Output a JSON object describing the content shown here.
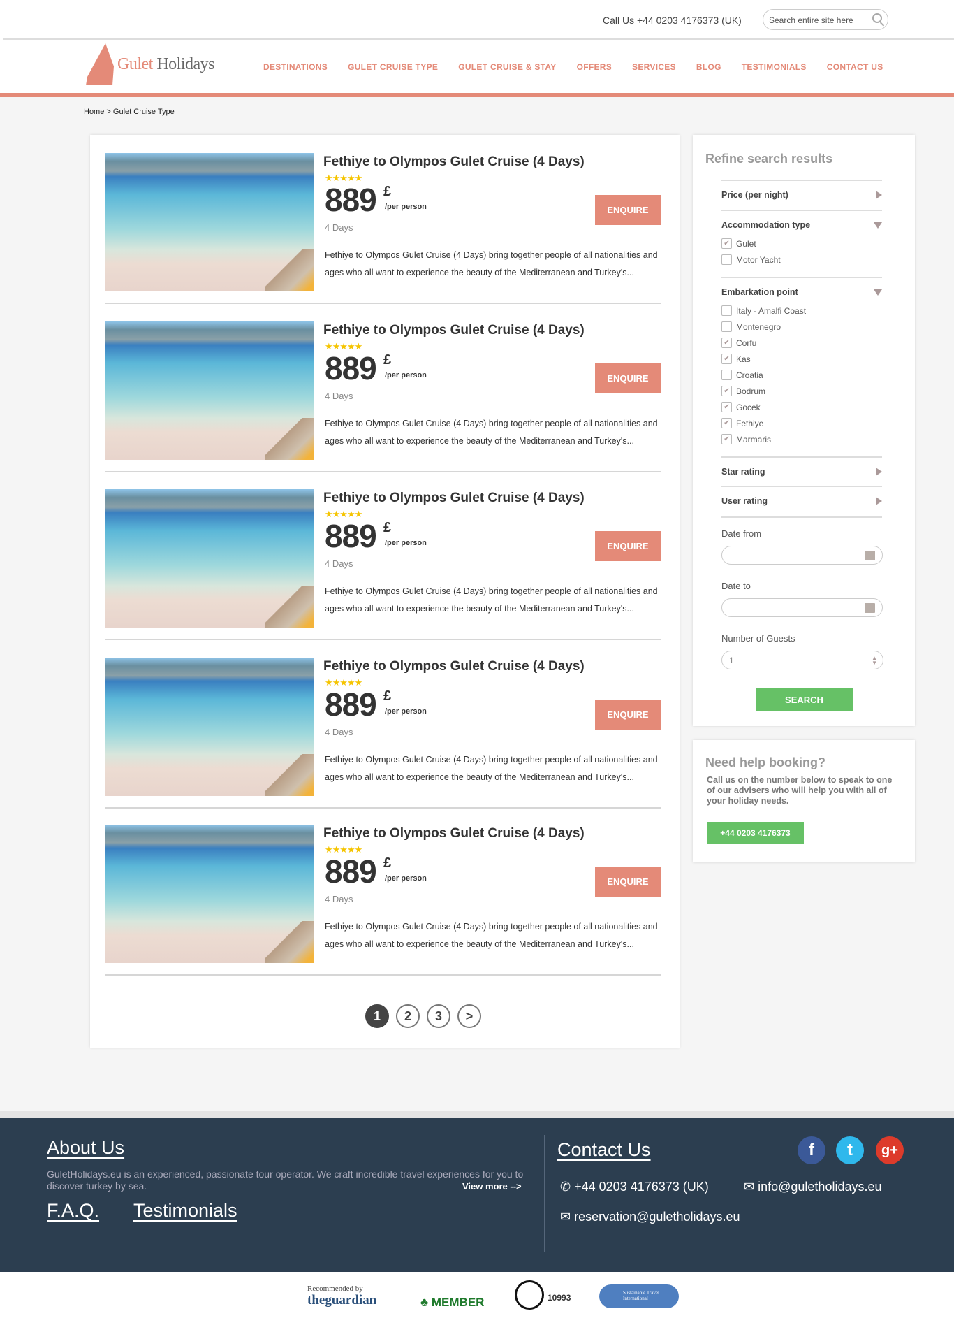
{
  "header": {
    "call_us": "Call Us +44 0203 4176373 (UK)",
    "search_placeholder": "Search entire site here",
    "logo_part1": "Gulet",
    "logo_part2": "Holidays",
    "nav": [
      "DESTINATIONS",
      "GULET CRUISE TYPE",
      "GULET CRUISE & STAY",
      "OFFERS",
      "SERVICES",
      "BLOG",
      "TESTIMONIALS",
      "CONTACT US"
    ]
  },
  "breadcrumb": {
    "home": "Home",
    "sep": ">",
    "current": "Gulet Cruise Type"
  },
  "colors": {
    "accent": "#e48a78",
    "green": "#66c166",
    "footer": "#2c3e50"
  },
  "listings": [
    {
      "title": "Fethiye to Olympos Gulet Cruise (4 Days)",
      "stars": "★★★★★",
      "price": "889",
      "currency": "£",
      "per": "/per person",
      "duration": "4 Days",
      "description": "Fethiye to Olympos Gulet Cruise (4 Days) bring together people of  all nationalities and ages who all want to experience the beauty of the  Mediterranean and Turkey's...",
      "button": "ENQUIRE"
    },
    {
      "title": "Fethiye to Olympos Gulet Cruise (4 Days)",
      "stars": "★★★★★",
      "price": "889",
      "currency": "£",
      "per": "/per person",
      "duration": "4 Days",
      "description": "Fethiye to Olympos Gulet Cruise (4 Days) bring together people of  all nationalities and ages who all want to experience the beauty of the  Mediterranean and Turkey's...",
      "button": "ENQUIRE"
    },
    {
      "title": "Fethiye to Olympos Gulet Cruise (4 Days)",
      "stars": "★★★★★",
      "price": "889",
      "currency": "£",
      "per": "/per person",
      "duration": "4 Days",
      "description": "Fethiye to Olympos Gulet Cruise (4 Days) bring together people of  all nationalities and ages who all want to experience the beauty of the  Mediterranean and Turkey's...",
      "button": "ENQUIRE"
    },
    {
      "title": "Fethiye to Olympos Gulet Cruise (4 Days)",
      "stars": "★★★★★",
      "price": "889",
      "currency": "£",
      "per": "/per person",
      "duration": "4 Days",
      "description": "Fethiye to Olympos Gulet Cruise (4 Days) bring together people of  all nationalities and ages who all want to experience the beauty of the  Mediterranean and Turkey's...",
      "button": "ENQUIRE"
    },
    {
      "title": "Fethiye to Olympos Gulet Cruise (4 Days)",
      "stars": "★★★★★",
      "price": "889",
      "currency": "£",
      "per": "/per person",
      "duration": "4 Days",
      "description": "Fethiye to Olympos Gulet Cruise (4 Days) bring together people of  all nationalities and ages who all want to experience the beauty of the  Mediterranean and Turkey's...",
      "button": "ENQUIRE"
    }
  ],
  "pagination": {
    "pages": [
      "1",
      "2",
      "3"
    ],
    "next": ">",
    "current": 1
  },
  "refine": {
    "title": "Refine search results",
    "price": "Price (per night)",
    "accommodation": "Accommodation type",
    "accommodation_options": [
      {
        "label": "Gulet",
        "checked": true
      },
      {
        "label": "Motor Yacht",
        "checked": false
      }
    ],
    "embarkation": "Embarkation point",
    "embarkation_options": [
      {
        "label": "Italy - Amalfi Coast",
        "checked": false
      },
      {
        "label": "Montenegro",
        "checked": false
      },
      {
        "label": "Corfu",
        "checked": true
      },
      {
        "label": "Kas",
        "checked": true
      },
      {
        "label": "Croatia",
        "checked": false
      },
      {
        "label": "Bodrum",
        "checked": true
      },
      {
        "label": "Gocek",
        "checked": true
      },
      {
        "label": "Fethiye",
        "checked": true
      },
      {
        "label": "Marmaris",
        "checked": true
      }
    ],
    "star_rating": "Star rating",
    "user_rating": "User rating",
    "date_from": "Date from",
    "date_to": "Date to",
    "guests_label": "Number of Guests",
    "guests_value": "1",
    "search_button": "SEARCH"
  },
  "help": {
    "title": "Need help booking?",
    "text": "Call us on the number below to speak to one of our advisers who will help you with all of your holiday needs.",
    "phone_button": "+44 0203 4176373"
  },
  "footer": {
    "about_title": "About Us",
    "about_text": "GuletHolidays.eu is an experienced, passionate tour operator. We craft incredible travel experiences for you to discover turkey by sea.",
    "view_more": "View more -->",
    "faq": "F.A.Q.",
    "testimonials": "Testimonials",
    "contact_title": "Contact Us",
    "phone": "+44 0203 4176373 (UK)",
    "email1": "info@guletholidays.eu",
    "email2": "reservation@guletholidays.eu"
  },
  "partners": {
    "guardian_top": "Recommended by",
    "guardian": "theguardian",
    "ecotourism": "MEMBER",
    "abta": "10993",
    "sti": "Sustainable Travel International"
  }
}
